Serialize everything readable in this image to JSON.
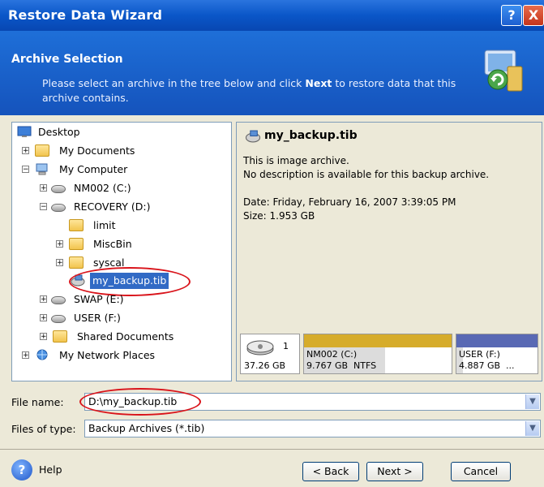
{
  "window": {
    "title": "Restore Data Wizard",
    "help_glyph": "?",
    "close_glyph": "X"
  },
  "header": {
    "title": "Archive Selection",
    "desc_before": "Please select an archive in the tree below and click ",
    "desc_bold": "Next",
    "desc_after": " to restore data that this archive contains.",
    "icon": "restore-wizard-icon"
  },
  "tree": {
    "items": [
      {
        "label": "Desktop",
        "icon": "desktop-icon"
      },
      {
        "label": "My Documents",
        "icon": "documents-folder-icon"
      },
      {
        "label": "My Computer",
        "icon": "computer-icon"
      },
      {
        "label": "NM002 (C:)",
        "icon": "drive-icon"
      },
      {
        "label": "RECOVERY (D:)",
        "icon": "drive-icon"
      },
      {
        "label": "limit",
        "icon": "folder-icon"
      },
      {
        "label": "MiscBin",
        "icon": "folder-icon"
      },
      {
        "label": "syscal",
        "icon": "folder-icon"
      },
      {
        "label": "my_backup.tib",
        "icon": "backup-archive-icon",
        "selected": true
      },
      {
        "label": "SWAP (E:)",
        "icon": "drive-icon"
      },
      {
        "label": "USER (F:)",
        "icon": "drive-icon"
      },
      {
        "label": "Shared Documents",
        "icon": "folder-icon"
      },
      {
        "label": "My Network Places",
        "icon": "network-places-icon"
      }
    ]
  },
  "info": {
    "title": "my_backup.tib",
    "line1": "This is image archive.",
    "line2": "No description is available for this backup archive.",
    "date": "Date: Friday, February 16, 2007 3:39:05 PM",
    "size": "Size: 1.953 GB"
  },
  "disk": {
    "number": "1",
    "size": "37.26 GB",
    "partitions": [
      {
        "name": "NM002 (C:)",
        "detail": "9.767 GB  NTFS",
        "color": "#d6ac2b",
        "used": 0.55
      },
      {
        "name": "USER (F:)",
        "detail": "4.887 GB  ...",
        "color": "#5969b4",
        "used": 0.08
      }
    ]
  },
  "filename": {
    "label": "File name:",
    "value": "D:\\my_backup.tib"
  },
  "filetype": {
    "label": "Files of type:",
    "value": "Backup Archives (*.tib)"
  },
  "buttons": {
    "help": "Help",
    "back": "< Back",
    "next": "Next >",
    "cancel": "Cancel"
  },
  "colors": {
    "titlebar": "#0a56c8",
    "header": "#1553bc",
    "selection": "#316ac5",
    "annotation_circle": "#d9141b"
  }
}
